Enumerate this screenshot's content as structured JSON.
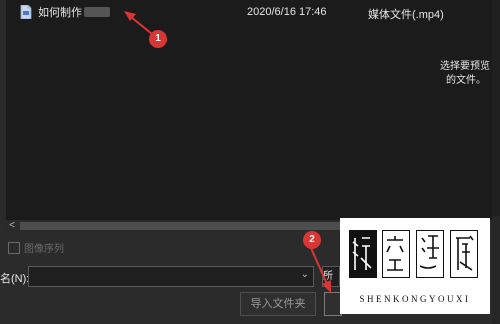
{
  "file_list": {
    "rows": [
      {
        "name": "如何制作",
        "date": "2020/6/16 17:46",
        "type": "媒体文件(.mp4)"
      }
    ]
  },
  "preview_pane": {
    "line1": "选择要预览",
    "line2": "的文件。"
  },
  "options": {
    "image_sequence_label": "图像序列"
  },
  "filename": {
    "label": "名(N):",
    "value": "",
    "filter_text": "所"
  },
  "buttons": {
    "import_folder": "导入文件夹",
    "confirm": ""
  },
  "annotations": {
    "badge1": "1",
    "badge2": "2"
  },
  "watermark": {
    "text": "SHENKONGYOUXI",
    "seal_chars": "深空游戲"
  },
  "colors": {
    "annotation_red": "#d93535",
    "background": "#202020"
  }
}
